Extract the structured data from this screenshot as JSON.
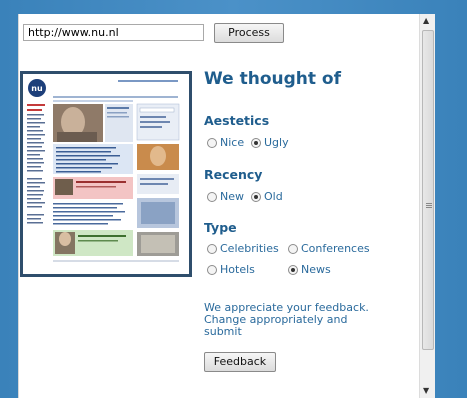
{
  "url_input": {
    "value": "http://www.nu.nl"
  },
  "process_button": "Process",
  "heading": "We thought of",
  "sections": {
    "aestetics": {
      "title": "Aestetics",
      "options": [
        {
          "label": "Nice",
          "checked": false
        },
        {
          "label": "Ugly",
          "checked": true
        }
      ]
    },
    "recency": {
      "title": "Recency",
      "options": [
        {
          "label": "New",
          "checked": false
        },
        {
          "label": "Old",
          "checked": true
        }
      ]
    },
    "type": {
      "title": "Type",
      "options": [
        {
          "label": "Celebrities",
          "checked": false
        },
        {
          "label": "Conferences",
          "checked": false
        },
        {
          "label": "Hotels",
          "checked": false
        },
        {
          "label": "News",
          "checked": true
        }
      ]
    }
  },
  "feedback_text": "We appreciate your feedback. Change appropriately and submit",
  "feedback_button": "Feedback",
  "thumbnail": {
    "logo_text": "nu"
  },
  "colors": {
    "heading": "#1f5d8d",
    "accent_blue": "#3f87be",
    "frame": "#2f4e6c"
  }
}
